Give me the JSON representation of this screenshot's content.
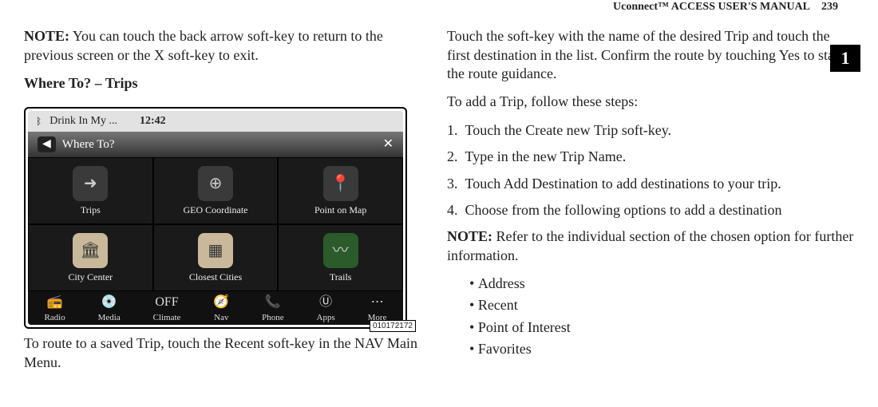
{
  "header": {
    "manual_title": "Uconnect™ ACCESS USER'S MANUAL",
    "page_number": "239",
    "section_badge": "1"
  },
  "left": {
    "note_label": "NOTE:",
    "note_text": " You can touch the back arrow soft-key to return to the previous screen or the X soft-key to exit.",
    "heading": "Where To? – Trips",
    "caption": "To route to a saved Trip, touch the Recent soft-key in the NAV Main Menu.",
    "image_number": "010172172"
  },
  "device": {
    "status_app": "Drink In My ...",
    "status_time": "12:42",
    "title_bar": "Where To?",
    "icons": [
      {
        "label": "Trips",
        "glyph": "➜"
      },
      {
        "label": "GEO Coordinate",
        "glyph": "⊕"
      },
      {
        "label": "Point on Map",
        "glyph": "📍"
      },
      {
        "label": "City Center",
        "glyph": "🏛"
      },
      {
        "label": "Closest Cities",
        "glyph": "▦"
      },
      {
        "label": "Trails",
        "glyph": "〰"
      }
    ],
    "nav": [
      {
        "label": "Radio",
        "glyph": "📻"
      },
      {
        "label": "Media",
        "glyph": "💿"
      },
      {
        "label": "Climate",
        "glyph": "OFF"
      },
      {
        "label": "Nav",
        "glyph": "🧭"
      },
      {
        "label": "Phone",
        "glyph": "📞"
      },
      {
        "label": "Apps",
        "glyph": "Ⓤ"
      },
      {
        "label": "More",
        "glyph": "⋯"
      }
    ]
  },
  "right": {
    "p1": "Touch the soft-key with the name of the desired Trip and touch the first destination in the list. Confirm the route by touching Yes to start the route guidance.",
    "p2": "To add a Trip, follow these steps:",
    "steps": [
      "Touch the Create new Trip soft-key.",
      "Type in the new Trip Name.",
      "Touch Add Destination to add destinations to your trip.",
      "Choose from the following options to add a destina­tion"
    ],
    "note2_label": "NOTE:",
    "note2_text": " Refer to the individual section of the chosen option for further information.",
    "bullets": [
      "Address",
      "Recent",
      "Point of Interest",
      "Favorites"
    ]
  }
}
